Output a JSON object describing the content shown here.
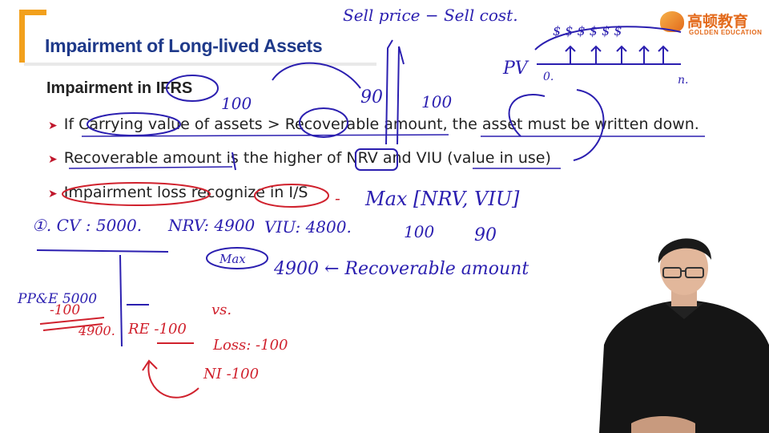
{
  "slide": {
    "title": "Impairment of Long-lived Assets",
    "subheading": "Impairment in IFRS",
    "bullets": [
      "If Carrying value of assets > Recoverable amount, the asset must be written down.",
      "Recoverable amount is the higher of NRV and VIU (value in use)",
      "Impairment loss recognize in I/S"
    ]
  },
  "logo": {
    "name_cn": "高顿教育",
    "name_en": "GOLDEN EDUCATION"
  },
  "annotations": {
    "top_formula": "Sell price  − Sell cost.",
    "pv_label": "PV",
    "pv_zero": "0.",
    "pv_n": "n.",
    "pv_cashflows": "$ $ $ $ $ $",
    "num_100_a": "100",
    "num_90": "90",
    "num_100_b": "100",
    "max_formula": "Max [NRV, VIU]",
    "max_100": "100",
    "max_90": "90",
    "example_cv": "①. CV : 5000.",
    "example_nrv": "NRV: 4900",
    "example_viu": "VIU: 4800.",
    "max_oval": "Max",
    "recoverable": "4900 ← Recoverable amount",
    "ppe_label": "PP&E 5000",
    "ppe_minus": "-100",
    "ppe_result": "4900.",
    "re_label": "RE -100",
    "vs": "vs.",
    "loss": "Loss: -100",
    "ni": "NI -100"
  },
  "colors": {
    "title_blue": "#1f3a8a",
    "accent_orange": "#f2a01c",
    "ink_blue": "#2b1fb0",
    "ink_red": "#d0212d",
    "bullet_red": "#c0172c"
  }
}
